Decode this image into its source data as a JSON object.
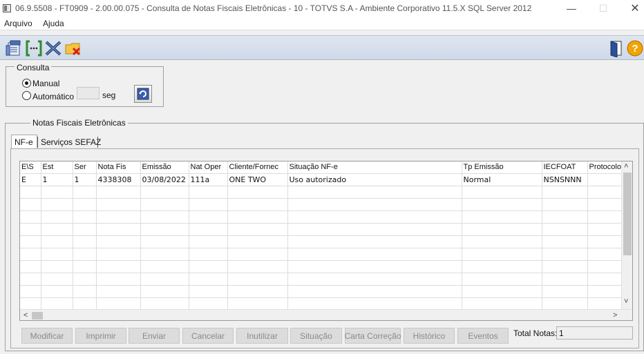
{
  "titlebar": {
    "title": "06.9.5508 - FT0909 - 2.00.00.075 - Consulta de Notas Fiscais Eletrônicas - 10 - TOTVS S.A - Ambiente Corporativo 11.5.X SQL Server 2012",
    "minimize": "—",
    "maximize": "☐",
    "close": "✕"
  },
  "menu": {
    "items": [
      "Arquivo",
      "Ajuda"
    ]
  },
  "toolbar": {
    "icons": [
      "report-icon",
      "filter-icon",
      "excel-icon",
      "folder-cancel-icon",
      "exit-door-icon",
      "help-icon"
    ]
  },
  "consulta": {
    "legend": "Consulta",
    "manual_label": "Manual",
    "manual_selected": true,
    "auto_label": "Automático",
    "auto_value": "",
    "seg_label": "seg"
  },
  "nfe_section": {
    "legend": "Notas Fiscais Eletrônicas",
    "tabs": [
      "NF-e",
      "Serviços SEFAZ"
    ],
    "active_tab": "NF-e"
  },
  "grid": {
    "columns": [
      "E\\S",
      "Est",
      "Ser",
      "Nota Fis",
      "Emissão",
      "Nat Oper",
      "Cliente/Fornec",
      "Situação NF-e",
      "Tp Emissão",
      "IECFOAT",
      "Protocolo"
    ],
    "rows": [
      [
        "E",
        "1",
        "1",
        "4338308",
        "03/08/2022",
        "111a",
        "ONE TWO",
        "Uso autorizado",
        "Normal",
        "NSNSNNN",
        ""
      ]
    ],
    "empty_rows": 10,
    "scroll_up": "˄",
    "scroll_down": "˅",
    "scroll_left": "<",
    "scroll_right": ">"
  },
  "buttons": [
    "Modificar",
    "Imprimir",
    "Enviar",
    "Cancelar",
    "Inutilizar",
    "Situação",
    "Carta Correção",
    "Histórico",
    "Eventos"
  ],
  "total": {
    "label": "Total Notas:",
    "value": "1"
  }
}
